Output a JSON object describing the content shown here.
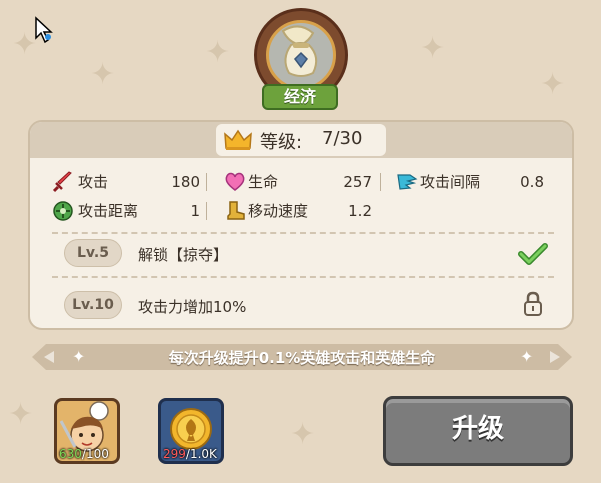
{
  "emblem": {
    "label": "经济"
  },
  "level": {
    "label": "等级:",
    "value": "7/30"
  },
  "stats": {
    "attack": {
      "label": "攻击",
      "value": "180"
    },
    "hp": {
      "label": "生命",
      "value": "257"
    },
    "attack_interval": {
      "label": "攻击间隔",
      "value": "0.8"
    },
    "attack_range": {
      "label": "攻击距离",
      "value": "1"
    },
    "move_speed": {
      "label": "移动速度",
      "value": "1.2"
    }
  },
  "unlocks": [
    {
      "level": "Lv.5",
      "text": "解锁【掠夺】",
      "status": "unlocked"
    },
    {
      "level": "Lv.10",
      "text": "攻击力增加10%",
      "status": "locked"
    }
  ],
  "banner": {
    "text": "每次升级提升0.1%英雄攻击和英雄生命"
  },
  "costs": {
    "hero_card": {
      "owned": "630",
      "required": "/100",
      "owned_color": "#7ed957"
    },
    "gold": {
      "owned": "299",
      "required": "/1.0K",
      "owned_color": "#ff5a5a"
    }
  },
  "upgrade_button": {
    "label": "升级"
  }
}
